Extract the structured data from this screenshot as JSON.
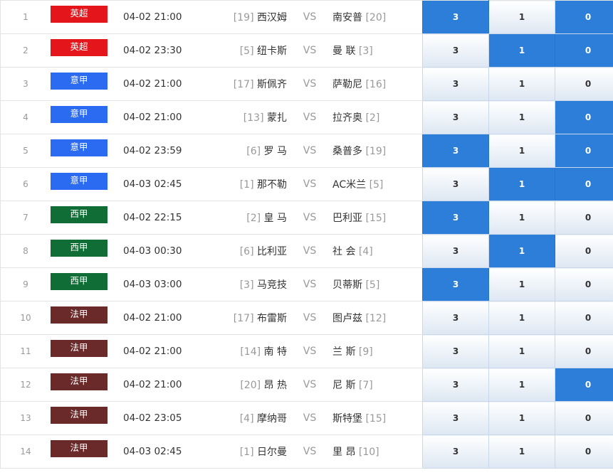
{
  "league_colors": {
    "英超": "#e4161c",
    "意甲": "#2a6bf2",
    "西甲": "#0f6d35",
    "法甲": "#6b2a2a"
  },
  "selected_color": "#2c7ed8",
  "vs_label": "VS",
  "rows": [
    {
      "idx": "1",
      "league": "英超",
      "time": "04-02 21:00",
      "home_rank": "[19]",
      "home": "西汉姆",
      "away": "南安普",
      "away_rank": "[20]",
      "odds": [
        {
          "v": "3",
          "selected": true
        },
        {
          "v": "1",
          "selected": false
        },
        {
          "v": "0",
          "selected": true
        }
      ]
    },
    {
      "idx": "2",
      "league": "英超",
      "time": "04-02 23:30",
      "home_rank": "[5]",
      "home": "纽卡斯",
      "away": "曼 联",
      "away_rank": "[3]",
      "odds": [
        {
          "v": "3",
          "selected": false
        },
        {
          "v": "1",
          "selected": true
        },
        {
          "v": "0",
          "selected": true
        }
      ]
    },
    {
      "idx": "3",
      "league": "意甲",
      "time": "04-02 21:00",
      "home_rank": "[17]",
      "home": "斯佩齐",
      "away": "萨勒尼",
      "away_rank": "[16]",
      "odds": [
        {
          "v": "3",
          "selected": false
        },
        {
          "v": "1",
          "selected": false
        },
        {
          "v": "0",
          "selected": false
        }
      ]
    },
    {
      "idx": "4",
      "league": "意甲",
      "time": "04-02 21:00",
      "home_rank": "[13]",
      "home": "蒙扎",
      "away": "拉齐奥",
      "away_rank": "[2]",
      "odds": [
        {
          "v": "3",
          "selected": false
        },
        {
          "v": "1",
          "selected": false
        },
        {
          "v": "0",
          "selected": true
        }
      ]
    },
    {
      "idx": "5",
      "league": "意甲",
      "time": "04-02 23:59",
      "home_rank": "[6]",
      "home": "罗 马",
      "away": "桑普多",
      "away_rank": "[19]",
      "odds": [
        {
          "v": "3",
          "selected": true
        },
        {
          "v": "1",
          "selected": false
        },
        {
          "v": "0",
          "selected": true
        }
      ]
    },
    {
      "idx": "6",
      "league": "意甲",
      "time": "04-03 02:45",
      "home_rank": "[1]",
      "home": "那不勒",
      "away": "AC米兰",
      "away_rank": "[5]",
      "odds": [
        {
          "v": "3",
          "selected": false
        },
        {
          "v": "1",
          "selected": true
        },
        {
          "v": "0",
          "selected": true
        }
      ]
    },
    {
      "idx": "7",
      "league": "西甲",
      "time": "04-02 22:15",
      "home_rank": "[2]",
      "home": "皇 马",
      "away": "巴利亚",
      "away_rank": "[15]",
      "odds": [
        {
          "v": "3",
          "selected": true
        },
        {
          "v": "1",
          "selected": false
        },
        {
          "v": "0",
          "selected": false
        }
      ]
    },
    {
      "idx": "8",
      "league": "西甲",
      "time": "04-03 00:30",
      "home_rank": "[6]",
      "home": "比利亚",
      "away": "社 会",
      "away_rank": "[4]",
      "odds": [
        {
          "v": "3",
          "selected": false
        },
        {
          "v": "1",
          "selected": true
        },
        {
          "v": "0",
          "selected": false
        }
      ]
    },
    {
      "idx": "9",
      "league": "西甲",
      "time": "04-03 03:00",
      "home_rank": "[3]",
      "home": "马竞技",
      "away": "贝蒂斯",
      "away_rank": "[5]",
      "odds": [
        {
          "v": "3",
          "selected": true
        },
        {
          "v": "1",
          "selected": false
        },
        {
          "v": "0",
          "selected": false
        }
      ]
    },
    {
      "idx": "10",
      "league": "法甲",
      "time": "04-02 21:00",
      "home_rank": "[17]",
      "home": "布雷斯",
      "away": "图卢兹",
      "away_rank": "[12]",
      "odds": [
        {
          "v": "3",
          "selected": false
        },
        {
          "v": "1",
          "selected": false
        },
        {
          "v": "0",
          "selected": false
        }
      ]
    },
    {
      "idx": "11",
      "league": "法甲",
      "time": "04-02 21:00",
      "home_rank": "[14]",
      "home": "南 特",
      "away": "兰 斯",
      "away_rank": "[9]",
      "odds": [
        {
          "v": "3",
          "selected": false
        },
        {
          "v": "1",
          "selected": false
        },
        {
          "v": "0",
          "selected": false
        }
      ]
    },
    {
      "idx": "12",
      "league": "法甲",
      "time": "04-02 21:00",
      "home_rank": "[20]",
      "home": "昂 热",
      "away": "尼 斯",
      "away_rank": "[7]",
      "odds": [
        {
          "v": "3",
          "selected": false
        },
        {
          "v": "1",
          "selected": false
        },
        {
          "v": "0",
          "selected": true
        }
      ]
    },
    {
      "idx": "13",
      "league": "法甲",
      "time": "04-02 23:05",
      "home_rank": "[4]",
      "home": "摩纳哥",
      "away": "斯特堡",
      "away_rank": "[15]",
      "odds": [
        {
          "v": "3",
          "selected": false
        },
        {
          "v": "1",
          "selected": false
        },
        {
          "v": "0",
          "selected": false
        }
      ]
    },
    {
      "idx": "14",
      "league": "法甲",
      "time": "04-03 02:45",
      "home_rank": "[1]",
      "home": "日尔曼",
      "away": "里 昂",
      "away_rank": "[10]",
      "odds": [
        {
          "v": "3",
          "selected": false
        },
        {
          "v": "1",
          "selected": false
        },
        {
          "v": "0",
          "selected": false
        }
      ]
    }
  ]
}
